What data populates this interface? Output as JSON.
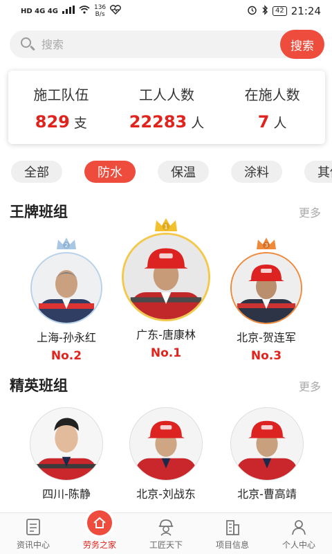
{
  "statusbar": {
    "network": "HD 4G 4G",
    "speed_value": "136",
    "speed_unit": "B/s",
    "battery": "42",
    "time": "21:24"
  },
  "search": {
    "placeholder": "搜索",
    "button": "搜索"
  },
  "stats": [
    {
      "label": "施工队伍",
      "value": "829",
      "unit": "支"
    },
    {
      "label": "工人人数",
      "value": "22283",
      "unit": "人"
    },
    {
      "label": "在施人数",
      "value": "7",
      "unit": "人"
    }
  ],
  "categories": [
    "全部",
    "防水",
    "保温",
    "涂料",
    "其他"
  ],
  "ace": {
    "title": "王牌班组",
    "more": "更多",
    "workers": [
      {
        "name": "上海-孙永红",
        "rank": "No.2",
        "badge": "2"
      },
      {
        "name": "广东-唐康林",
        "rank": "No.1",
        "badge": "1"
      },
      {
        "name": "北京-贺连军",
        "rank": "No.3",
        "badge": "3"
      }
    ]
  },
  "elite": {
    "title": "精英班组",
    "more": "更多",
    "workers": [
      {
        "name": "四川-陈静"
      },
      {
        "name": "北京-刘战东"
      },
      {
        "name": "北京-曹高靖"
      }
    ]
  },
  "nav": [
    {
      "label": "资讯中心",
      "icon": "document-icon"
    },
    {
      "label": "劳务之家",
      "icon": "home-icon"
    },
    {
      "label": "工匠天下",
      "icon": "worker-helmet-icon"
    },
    {
      "label": "项目信息",
      "icon": "building-icon"
    },
    {
      "label": "个人中心",
      "icon": "person-icon"
    }
  ],
  "colors": {
    "accent": "#ee4c3c",
    "number_red": "#e0231c",
    "gold": "#f3c02d",
    "silver": "#a9c7e3",
    "bronze": "#ef8a3b"
  }
}
